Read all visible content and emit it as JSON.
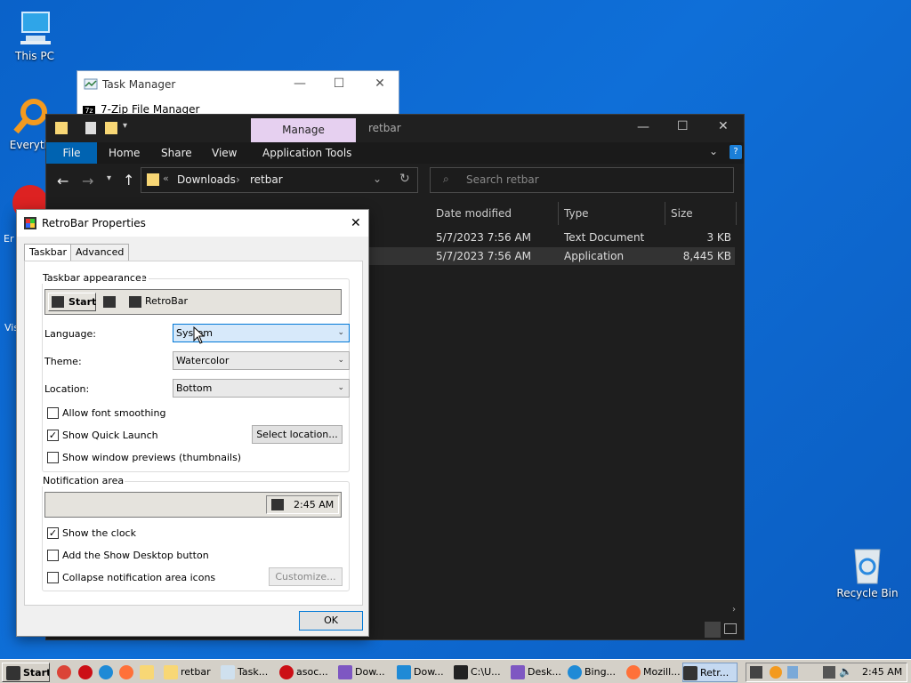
{
  "desktop": {
    "this_pc": "This PC",
    "everything": "Everyth",
    "recycle_bin": "Recycle Bin",
    "partial_labels": [
      "Er",
      "Vis"
    ]
  },
  "task_manager": {
    "title": "Task Manager",
    "menu_item": "7-Zip File Manager"
  },
  "explorer": {
    "contextual_tab": "Manage",
    "title": "retbar",
    "ribbon_tabs": [
      "File",
      "Home",
      "Share",
      "View",
      "Application Tools"
    ],
    "breadcrumb": [
      "Downloads",
      "retbar"
    ],
    "search_placeholder": "Search retbar",
    "columns": [
      "Date modified",
      "Type",
      "Size"
    ],
    "files": [
      {
        "date": "5/7/2023 7:56 AM",
        "type": "Text Document",
        "size": "3 KB"
      },
      {
        "date": "5/7/2023 7:56 AM",
        "type": "Application",
        "size": "8,445 KB"
      }
    ]
  },
  "dialog": {
    "title": "RetroBar Properties",
    "tabs": [
      "Taskbar",
      "Advanced"
    ],
    "taskbar_appearance": {
      "label": "Taskbar appearance",
      "start_label": "Start",
      "preview_app": "RetroBar"
    },
    "language": {
      "label": "Language:",
      "value": "System"
    },
    "theme": {
      "label": "Theme:",
      "value": "Watercolor"
    },
    "location": {
      "label": "Location:",
      "value": "Bottom"
    },
    "options": {
      "font_smoothing": "Allow font smoothing",
      "quick_launch": "Show Quick Launch",
      "previews": "Show window previews (thumbnails)"
    },
    "select_location": "Select location...",
    "notification": {
      "label": "Notification area",
      "clock_preview": "2:45 AM",
      "show_clock": "Show the clock",
      "show_desktop": "Add the Show Desktop button",
      "collapse": "Collapse notification area icons",
      "customize": "Customize..."
    },
    "ok": "OK"
  },
  "taskbar": {
    "start": "Start",
    "items": [
      "retbar",
      "Task...",
      "asoc...",
      "Dow...",
      "Dow...",
      "C:\\U...",
      "Desk...",
      "Bing...",
      "Mozill...",
      "Retr..."
    ],
    "clock": "2:45 AM"
  },
  "colors": {
    "desktop": "#0b63c8",
    "explorer_bg": "#1e1e1e",
    "manage_tab": "#e6d0f0",
    "file_tab": "#0063b1",
    "dialog_bg": "#f0f0f0",
    "taskbar": "#d4d0c8",
    "selection": "#cce8ff"
  }
}
